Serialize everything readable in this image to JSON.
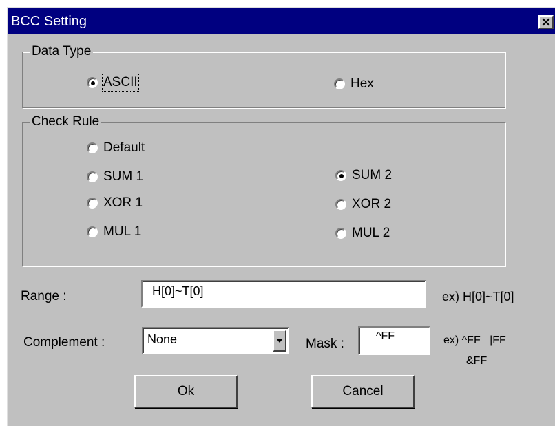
{
  "window": {
    "title": "BCC Setting",
    "close_symbol": "×"
  },
  "data_type": {
    "label": "Data Type",
    "options": [
      {
        "label": "ASCII",
        "checked": true
      },
      {
        "label": "Hex",
        "checked": false
      }
    ]
  },
  "check_rule": {
    "label": "Check Rule",
    "options": [
      {
        "label": "Default",
        "checked": false
      },
      {
        "label": "SUM 1",
        "checked": false
      },
      {
        "label": "SUM 2",
        "checked": true
      },
      {
        "label": "XOR 1",
        "checked": false
      },
      {
        "label": "XOR 2",
        "checked": false
      },
      {
        "label": "MUL 1",
        "checked": false
      },
      {
        "label": "MUL 2",
        "checked": false
      }
    ]
  },
  "range": {
    "label": "Range :",
    "value": "H[0]~T[0]",
    "example": "ex) H[0]~T[0]"
  },
  "complement": {
    "label": "Complement :",
    "selected": "None"
  },
  "mask": {
    "label": "Mask :",
    "value": "^FF",
    "example_line1": "ex) ^FF   |FF",
    "example_line2": "&FF"
  },
  "buttons": {
    "ok": "Ok",
    "cancel": "Cancel"
  }
}
